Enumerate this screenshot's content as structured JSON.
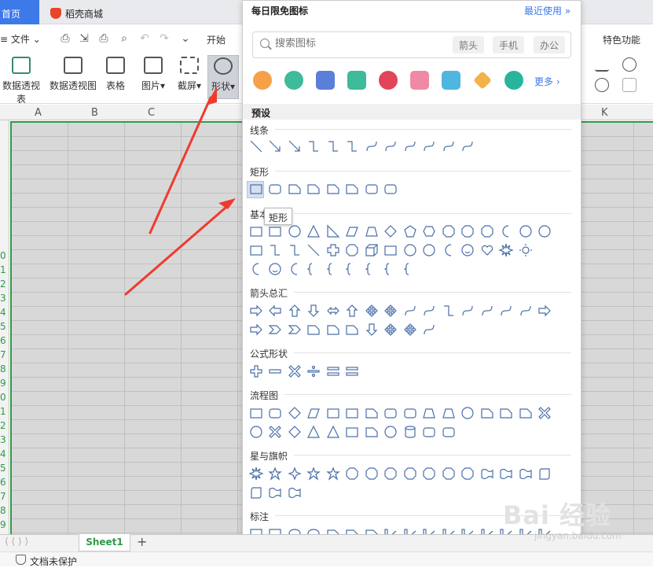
{
  "tabs": {
    "home": "首页",
    "store": "稻壳商城"
  },
  "menu": {
    "file": "文件",
    "start": "开始",
    "feature": "特色功能"
  },
  "ribbon": {
    "pivot_table": "数据透视表",
    "pivot_chart": "数据透视图",
    "table": "表格",
    "picture": "图片",
    "screenshot": "截屏",
    "shape": "形状"
  },
  "columns": [
    "A",
    "B",
    "C",
    "K"
  ],
  "rows": [
    "0",
    "1",
    "2",
    "3",
    "4",
    "5",
    "6",
    "7",
    "8",
    "9",
    "0",
    "1",
    "2",
    "3",
    "4",
    "5",
    "6",
    "7",
    "8",
    "9"
  ],
  "sheet": {
    "tab": "Sheet1",
    "add": "+"
  },
  "status": {
    "protect": "文档未保护"
  },
  "panel": {
    "title": "每日限免图标",
    "recent": "最近使用 »",
    "search_placeholder": "搜索图标",
    "chips": [
      "箭头",
      "手机",
      "办公"
    ],
    "more": "更多 ›",
    "preset": "预设",
    "sections": {
      "lines": "线条",
      "rect": "矩形",
      "basic": "基本形状",
      "arrows": "箭头总汇",
      "formula": "公式形状",
      "flowchart": "流程图",
      "stars": "星与旗帜",
      "callouts": "标注"
    },
    "tooltip": "矩形"
  },
  "colors": {
    "accent": "#3d79e8",
    "grid_border": "#2e9a48",
    "arrow": "#f03a2e"
  },
  "watermark": {
    "main": "Bai 经验",
    "sub": "jingyan.baidu.com"
  }
}
